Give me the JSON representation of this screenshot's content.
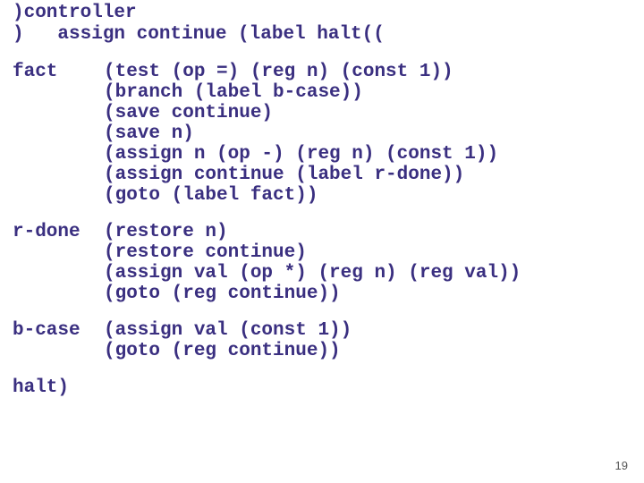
{
  "header": {
    "line1": ")controller",
    "line2": ")   assign continue (label halt(("
  },
  "blocks": [
    {
      "label": "fact",
      "code": "(test (op =) (reg n) (const 1))\n(branch (label b-case))\n(save continue)\n(save n)\n(assign n (op -) (reg n) (const 1))\n(assign continue (label r-done))\n(goto (label fact))"
    },
    {
      "label": "r-done",
      "code": "(restore n)\n(restore continue)\n(assign val (op *) (reg n) (reg val))\n(goto (reg continue))"
    },
    {
      "label": "b-case",
      "code": "(assign val (const 1))\n(goto (reg continue))"
    }
  ],
  "halt": "halt)",
  "page_number": "19"
}
